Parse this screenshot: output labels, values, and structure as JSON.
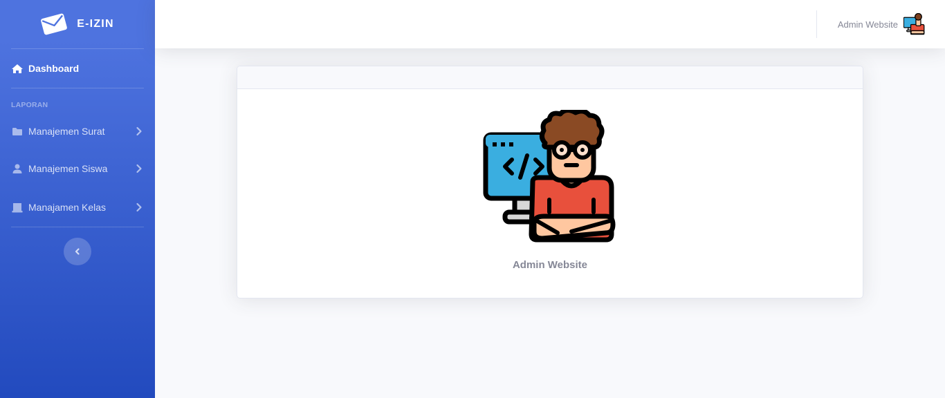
{
  "brand": {
    "name": "E-IZIN",
    "icon": "envelope-icon"
  },
  "sidebar": {
    "dashboard": {
      "label": "Dashboard",
      "icon": "home-icon"
    },
    "section_heading": "LAPORAN",
    "items": [
      {
        "label": "Manajemen Surat",
        "icon": "folder-icon"
      },
      {
        "label": "Manajemen Siswa",
        "icon": "user-icon"
      },
      {
        "label": "Manajamen Kelas",
        "icon": "classroom-icon"
      }
    ],
    "toggle_icon": "chevron-left-icon"
  },
  "topbar": {
    "user_name": "Admin Website",
    "avatar_icon": "developer-avatar-icon"
  },
  "profile_card": {
    "name": "Admin Website",
    "avatar_icon": "developer-avatar-icon"
  },
  "colors": {
    "sidebar_gradient_start": "#4e73df",
    "sidebar_gradient_end": "#224abe",
    "background": "#f8f9fc",
    "muted_text": "#858796"
  }
}
